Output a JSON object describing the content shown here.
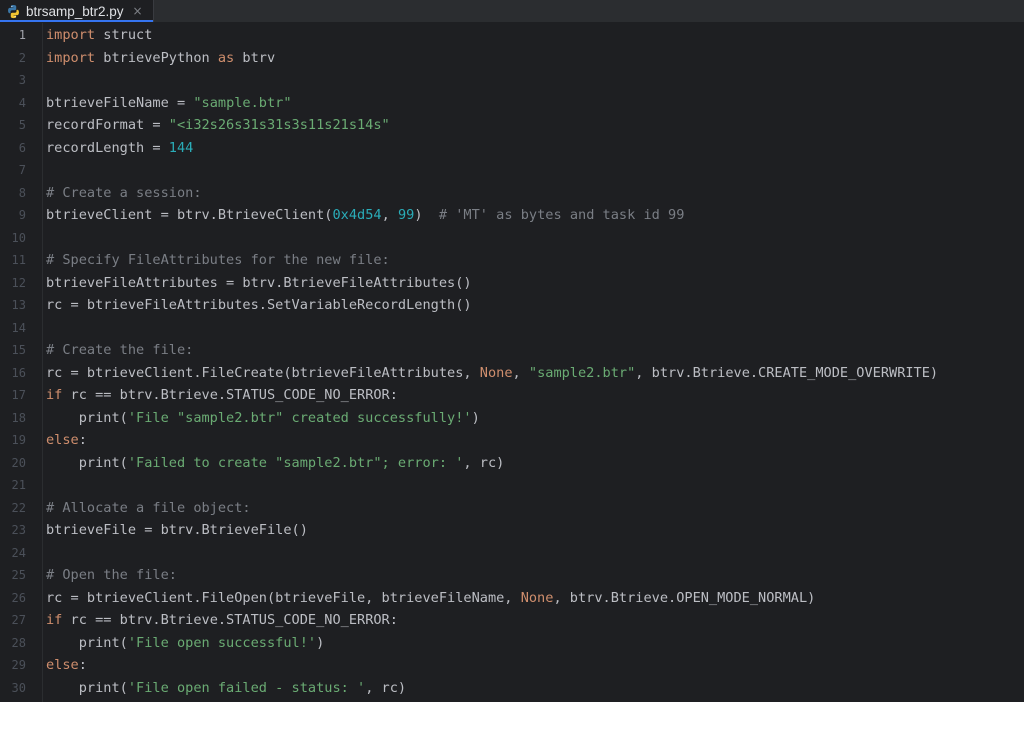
{
  "tab": {
    "filename": "btrsamp_btr2.py",
    "close_glyph": "×",
    "icon": "python-file-icon"
  },
  "colors": {
    "editor_bg": "#1e1f22",
    "keyword": "#cf8e6d",
    "string": "#6aab73",
    "number": "#2aacb8",
    "comment": "#7a7e85",
    "text": "#bcbec4",
    "line_number": "#4b5059"
  },
  "lines": [
    {
      "n": "1",
      "tokens": [
        {
          "t": "kw",
          "v": "import"
        },
        {
          "t": "plain",
          "v": " struct"
        }
      ]
    },
    {
      "n": "2",
      "tokens": [
        {
          "t": "kw",
          "v": "import"
        },
        {
          "t": "plain",
          "v": " btrievePython "
        },
        {
          "t": "kw",
          "v": "as"
        },
        {
          "t": "plain",
          "v": " btrv"
        }
      ]
    },
    {
      "n": "3",
      "tokens": []
    },
    {
      "n": "4",
      "tokens": [
        {
          "t": "plain",
          "v": "btrieveFileName = "
        },
        {
          "t": "str",
          "v": "\"sample.btr\""
        }
      ]
    },
    {
      "n": "5",
      "tokens": [
        {
          "t": "plain",
          "v": "recordFormat = "
        },
        {
          "t": "str",
          "v": "\"<i32s26s31s31s3s11s21s14s\""
        }
      ]
    },
    {
      "n": "6",
      "tokens": [
        {
          "t": "plain",
          "v": "recordLength = "
        },
        {
          "t": "num",
          "v": "144"
        }
      ]
    },
    {
      "n": "7",
      "tokens": []
    },
    {
      "n": "8",
      "tokens": [
        {
          "t": "com",
          "v": "# Create a session:"
        }
      ]
    },
    {
      "n": "9",
      "tokens": [
        {
          "t": "plain",
          "v": "btrieveClient = btrv.BtrieveClient("
        },
        {
          "t": "num",
          "v": "0x4d54"
        },
        {
          "t": "plain",
          "v": ", "
        },
        {
          "t": "num",
          "v": "99"
        },
        {
          "t": "plain",
          "v": ")  "
        },
        {
          "t": "com",
          "v": "# 'MT' as bytes and task id 99"
        }
      ]
    },
    {
      "n": "10",
      "tokens": []
    },
    {
      "n": "11",
      "tokens": [
        {
          "t": "com",
          "v": "# Specify FileAttributes for the new file:"
        }
      ]
    },
    {
      "n": "12",
      "tokens": [
        {
          "t": "plain",
          "v": "btrieveFileAttributes = btrv.BtrieveFileAttributes()"
        }
      ]
    },
    {
      "n": "13",
      "tokens": [
        {
          "t": "plain",
          "v": "rc = btrieveFileAttributes.SetVariableRecordLength()"
        }
      ]
    },
    {
      "n": "14",
      "tokens": []
    },
    {
      "n": "15",
      "tokens": [
        {
          "t": "com",
          "v": "# Create the file:"
        }
      ]
    },
    {
      "n": "16",
      "tokens": [
        {
          "t": "plain",
          "v": "rc = btrieveClient.FileCreate(btrieveFileAttributes, "
        },
        {
          "t": "kw",
          "v": "None"
        },
        {
          "t": "plain",
          "v": ", "
        },
        {
          "t": "str",
          "v": "\"sample2.btr\""
        },
        {
          "t": "plain",
          "v": ", btrv.Btrieve.CREATE_MODE_OVERWRITE)"
        }
      ]
    },
    {
      "n": "17",
      "tokens": [
        {
          "t": "kw",
          "v": "if"
        },
        {
          "t": "plain",
          "v": " rc == btrv.Btrieve.STATUS_CODE_NO_ERROR:"
        }
      ]
    },
    {
      "n": "18",
      "tokens": [
        {
          "t": "plain",
          "v": "    print("
        },
        {
          "t": "str",
          "v": "'File \"sample2.btr\" created successfully!'"
        },
        {
          "t": "plain",
          "v": ")"
        }
      ]
    },
    {
      "n": "19",
      "tokens": [
        {
          "t": "kw",
          "v": "else"
        },
        {
          "t": "plain",
          "v": ":"
        }
      ]
    },
    {
      "n": "20",
      "tokens": [
        {
          "t": "plain",
          "v": "    print("
        },
        {
          "t": "str",
          "v": "'Failed to create \"sample2.btr\"; error: '"
        },
        {
          "t": "plain",
          "v": ", rc)"
        }
      ]
    },
    {
      "n": "21",
      "tokens": []
    },
    {
      "n": "22",
      "tokens": [
        {
          "t": "com",
          "v": "# Allocate a file object:"
        }
      ]
    },
    {
      "n": "23",
      "tokens": [
        {
          "t": "plain",
          "v": "btrieveFile = btrv.BtrieveFile()"
        }
      ]
    },
    {
      "n": "24",
      "tokens": []
    },
    {
      "n": "25",
      "tokens": [
        {
          "t": "com",
          "v": "# Open the file:"
        }
      ]
    },
    {
      "n": "26",
      "tokens": [
        {
          "t": "plain",
          "v": "rc = btrieveClient.FileOpen(btrieveFile, btrieveFileName, "
        },
        {
          "t": "kw",
          "v": "None"
        },
        {
          "t": "plain",
          "v": ", btrv.Btrieve.OPEN_MODE_NORMAL)"
        }
      ]
    },
    {
      "n": "27",
      "tokens": [
        {
          "t": "kw",
          "v": "if"
        },
        {
          "t": "plain",
          "v": " rc == btrv.Btrieve.STATUS_CODE_NO_ERROR:"
        }
      ]
    },
    {
      "n": "28",
      "tokens": [
        {
          "t": "plain",
          "v": "    print("
        },
        {
          "t": "str",
          "v": "'File open successful!'"
        },
        {
          "t": "plain",
          "v": ")"
        }
      ]
    },
    {
      "n": "29",
      "tokens": [
        {
          "t": "kw",
          "v": "else"
        },
        {
          "t": "plain",
          "v": ":"
        }
      ]
    },
    {
      "n": "30",
      "tokens": [
        {
          "t": "plain",
          "v": "    print("
        },
        {
          "t": "str",
          "v": "'File open failed - status: '"
        },
        {
          "t": "plain",
          "v": ", rc)"
        }
      ]
    }
  ]
}
